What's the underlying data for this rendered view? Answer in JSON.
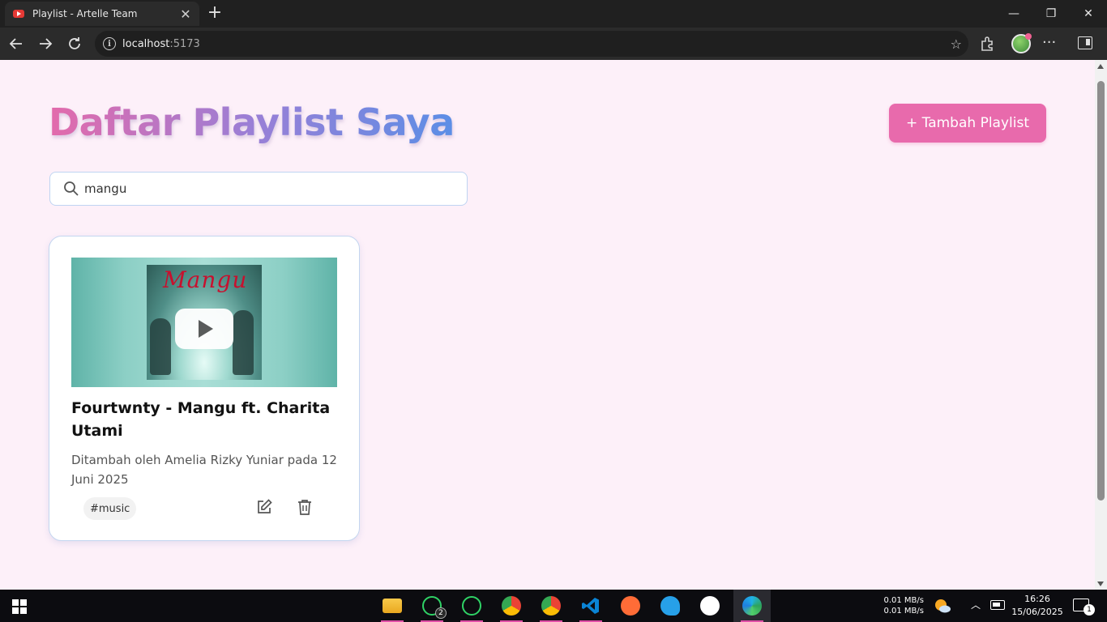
{
  "browser": {
    "tab_title": "Playlist - Artelle Team",
    "address_host": "localhost",
    "address_port": ":5173"
  },
  "page": {
    "title": "Daftar Playlist Saya",
    "add_button": "+ Tambah Playlist",
    "search": {
      "value": "mangu"
    },
    "cards": [
      {
        "title": "Fourtwnty - Mangu ft. Charita Utami",
        "meta": "Ditambah oleh Amelia Rizky Yuniar pada 12 Juni 2025",
        "tag": "#music",
        "thumb_text": "Mangu"
      }
    ]
  },
  "taskbar": {
    "whatsapp_badge": "2",
    "net_up": "0.01 MB/s",
    "net_down": "0.01 MB/s",
    "time": "16:26",
    "date": "15/06/2025",
    "notification_count": "1"
  },
  "colors": {
    "page_bg": "#fdf0f9",
    "accent_pink": "#e86aac",
    "title_gradient": [
      "#e36aab",
      "#9a7fd6",
      "#5b8ee6"
    ]
  }
}
